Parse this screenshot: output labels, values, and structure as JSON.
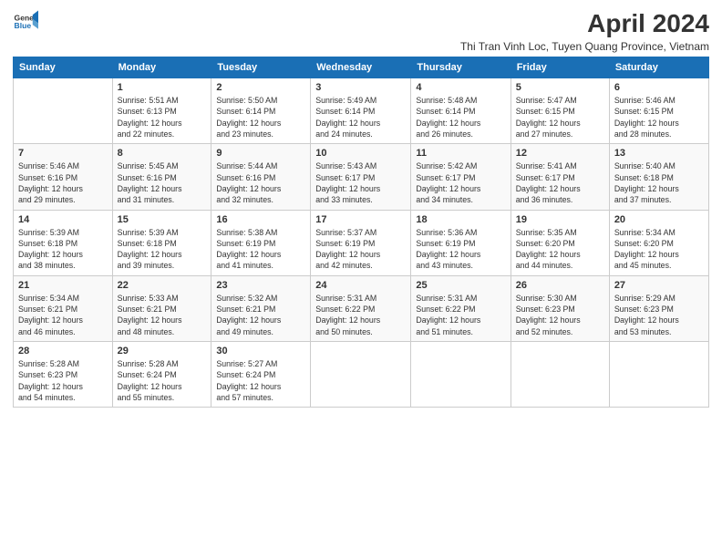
{
  "logo": {
    "line1": "General",
    "line2": "Blue"
  },
  "title": "April 2024",
  "subtitle": "Thi Tran Vinh Loc, Tuyen Quang Province, Vietnam",
  "header_days": [
    "Sunday",
    "Monday",
    "Tuesday",
    "Wednesday",
    "Thursday",
    "Friday",
    "Saturday"
  ],
  "weeks": [
    [
      {
        "day": "",
        "info": ""
      },
      {
        "day": "1",
        "info": "Sunrise: 5:51 AM\nSunset: 6:13 PM\nDaylight: 12 hours\nand 22 minutes."
      },
      {
        "day": "2",
        "info": "Sunrise: 5:50 AM\nSunset: 6:14 PM\nDaylight: 12 hours\nand 23 minutes."
      },
      {
        "day": "3",
        "info": "Sunrise: 5:49 AM\nSunset: 6:14 PM\nDaylight: 12 hours\nand 24 minutes."
      },
      {
        "day": "4",
        "info": "Sunrise: 5:48 AM\nSunset: 6:14 PM\nDaylight: 12 hours\nand 26 minutes."
      },
      {
        "day": "5",
        "info": "Sunrise: 5:47 AM\nSunset: 6:15 PM\nDaylight: 12 hours\nand 27 minutes."
      },
      {
        "day": "6",
        "info": "Sunrise: 5:46 AM\nSunset: 6:15 PM\nDaylight: 12 hours\nand 28 minutes."
      }
    ],
    [
      {
        "day": "7",
        "info": "Sunrise: 5:46 AM\nSunset: 6:16 PM\nDaylight: 12 hours\nand 29 minutes."
      },
      {
        "day": "8",
        "info": "Sunrise: 5:45 AM\nSunset: 6:16 PM\nDaylight: 12 hours\nand 31 minutes."
      },
      {
        "day": "9",
        "info": "Sunrise: 5:44 AM\nSunset: 6:16 PM\nDaylight: 12 hours\nand 32 minutes."
      },
      {
        "day": "10",
        "info": "Sunrise: 5:43 AM\nSunset: 6:17 PM\nDaylight: 12 hours\nand 33 minutes."
      },
      {
        "day": "11",
        "info": "Sunrise: 5:42 AM\nSunset: 6:17 PM\nDaylight: 12 hours\nand 34 minutes."
      },
      {
        "day": "12",
        "info": "Sunrise: 5:41 AM\nSunset: 6:17 PM\nDaylight: 12 hours\nand 36 minutes."
      },
      {
        "day": "13",
        "info": "Sunrise: 5:40 AM\nSunset: 6:18 PM\nDaylight: 12 hours\nand 37 minutes."
      }
    ],
    [
      {
        "day": "14",
        "info": "Sunrise: 5:39 AM\nSunset: 6:18 PM\nDaylight: 12 hours\nand 38 minutes."
      },
      {
        "day": "15",
        "info": "Sunrise: 5:39 AM\nSunset: 6:18 PM\nDaylight: 12 hours\nand 39 minutes."
      },
      {
        "day": "16",
        "info": "Sunrise: 5:38 AM\nSunset: 6:19 PM\nDaylight: 12 hours\nand 41 minutes."
      },
      {
        "day": "17",
        "info": "Sunrise: 5:37 AM\nSunset: 6:19 PM\nDaylight: 12 hours\nand 42 minutes."
      },
      {
        "day": "18",
        "info": "Sunrise: 5:36 AM\nSunset: 6:19 PM\nDaylight: 12 hours\nand 43 minutes."
      },
      {
        "day": "19",
        "info": "Sunrise: 5:35 AM\nSunset: 6:20 PM\nDaylight: 12 hours\nand 44 minutes."
      },
      {
        "day": "20",
        "info": "Sunrise: 5:34 AM\nSunset: 6:20 PM\nDaylight: 12 hours\nand 45 minutes."
      }
    ],
    [
      {
        "day": "21",
        "info": "Sunrise: 5:34 AM\nSunset: 6:21 PM\nDaylight: 12 hours\nand 46 minutes."
      },
      {
        "day": "22",
        "info": "Sunrise: 5:33 AM\nSunset: 6:21 PM\nDaylight: 12 hours\nand 48 minutes."
      },
      {
        "day": "23",
        "info": "Sunrise: 5:32 AM\nSunset: 6:21 PM\nDaylight: 12 hours\nand 49 minutes."
      },
      {
        "day": "24",
        "info": "Sunrise: 5:31 AM\nSunset: 6:22 PM\nDaylight: 12 hours\nand 50 minutes."
      },
      {
        "day": "25",
        "info": "Sunrise: 5:31 AM\nSunset: 6:22 PM\nDaylight: 12 hours\nand 51 minutes."
      },
      {
        "day": "26",
        "info": "Sunrise: 5:30 AM\nSunset: 6:23 PM\nDaylight: 12 hours\nand 52 minutes."
      },
      {
        "day": "27",
        "info": "Sunrise: 5:29 AM\nSunset: 6:23 PM\nDaylight: 12 hours\nand 53 minutes."
      }
    ],
    [
      {
        "day": "28",
        "info": "Sunrise: 5:28 AM\nSunset: 6:23 PM\nDaylight: 12 hours\nand 54 minutes."
      },
      {
        "day": "29",
        "info": "Sunrise: 5:28 AM\nSunset: 6:24 PM\nDaylight: 12 hours\nand 55 minutes."
      },
      {
        "day": "30",
        "info": "Sunrise: 5:27 AM\nSunset: 6:24 PM\nDaylight: 12 hours\nand 57 minutes."
      },
      {
        "day": "",
        "info": ""
      },
      {
        "day": "",
        "info": ""
      },
      {
        "day": "",
        "info": ""
      },
      {
        "day": "",
        "info": ""
      }
    ]
  ],
  "colors": {
    "header_bg": "#1a6fb5",
    "header_text": "#ffffff",
    "border": "#cccccc"
  }
}
